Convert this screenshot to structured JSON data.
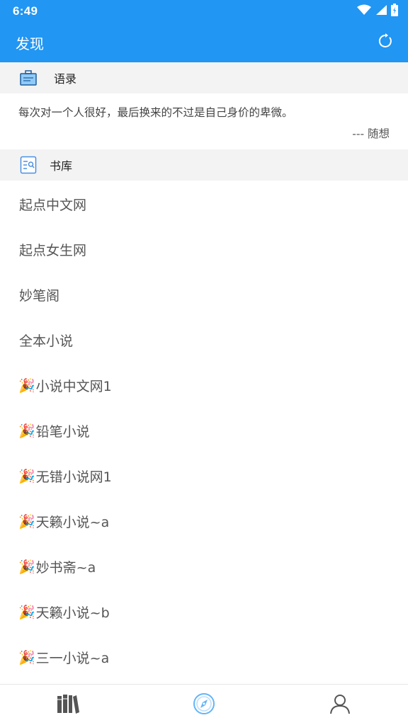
{
  "status_bar": {
    "time": "6:49"
  },
  "app_bar": {
    "title": "发现"
  },
  "quote_section": {
    "label": "语录",
    "text": "每次对一个人很好，最后换来的不过是自己身价的卑微。",
    "author": "--- 随想"
  },
  "library_section": {
    "label": "书库",
    "items": [
      {
        "prefix": "",
        "label": "起点中文网"
      },
      {
        "prefix": "",
        "label": "起点女生网"
      },
      {
        "prefix": "",
        "label": "妙笔阁"
      },
      {
        "prefix": "",
        "label": "全本小说"
      },
      {
        "prefix": "🎉",
        "label": "小说中文网1"
      },
      {
        "prefix": "🎉",
        "label": "铅笔小说"
      },
      {
        "prefix": "🎉",
        "label": "无错小说网1"
      },
      {
        "prefix": "🎉",
        "label": "天籁小说~a"
      },
      {
        "prefix": "🎉",
        "label": "妙书斋~a"
      },
      {
        "prefix": "🎉",
        "label": "天籁小说~b"
      },
      {
        "prefix": "🎉",
        "label": "三一小说~a"
      }
    ]
  },
  "bottom_nav": {
    "items": [
      {
        "icon": "bookshelf-icon",
        "active": false
      },
      {
        "icon": "compass-icon",
        "active": true
      },
      {
        "icon": "person-icon",
        "active": false
      }
    ]
  },
  "colors": {
    "primary": "#2196f3",
    "section_bg": "#f3f3f3",
    "nav_active": "#64b5f6",
    "nav_inactive": "#555555"
  }
}
